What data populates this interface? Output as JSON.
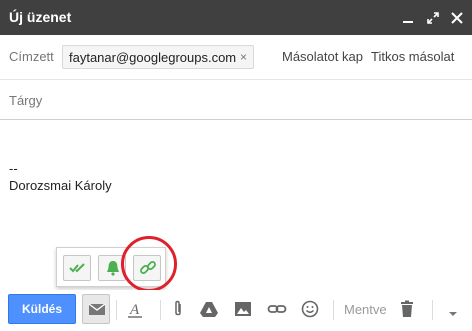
{
  "window": {
    "title": "Új üzenet",
    "icons": [
      "minimize-icon",
      "maximize-icon",
      "close-icon"
    ]
  },
  "recipients": {
    "to_label": "Címzett",
    "chip_email": "faytanar@googlegroups.com",
    "chip_remove": "×",
    "cc_label": "Másolatot kap",
    "bcc_label": "Titkos másolat"
  },
  "subject": {
    "placeholder": "Tárgy",
    "value": ""
  },
  "body": {
    "signature_separator": "--",
    "signature_name": "Dorozsmai Károly"
  },
  "labs_popup": {
    "buttons": [
      "double-check-icon",
      "bell-icon",
      "link-chain-icon"
    ],
    "accent_color": "#4caf50",
    "highlight_color": "#e0202a"
  },
  "toolbar": {
    "send_label": "Küldés",
    "saved_label": "Mentve",
    "send_color": "#4d90fe",
    "icons": [
      "labs-envelope-icon",
      "text-format-icon",
      "paperclip-icon",
      "drive-icon",
      "photo-icon",
      "link-icon",
      "emoji-icon",
      "trash-icon",
      "more-options-icon"
    ]
  }
}
